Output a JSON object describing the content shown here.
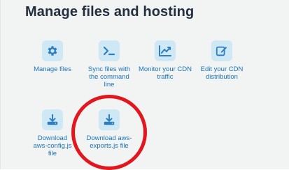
{
  "section": {
    "title": "Manage files and hosting"
  },
  "tiles": [
    {
      "icon": "gear-icon",
      "label": "Manage files"
    },
    {
      "icon": "terminal-icon",
      "label": "Sync files with the command line"
    },
    {
      "icon": "line-chart-icon",
      "label": "Monitor your CDN traffic"
    },
    {
      "icon": "edit-icon",
      "label": "Edit your CDN distribution"
    },
    {
      "icon": "download-icon",
      "label": "Download aws-config.js file"
    },
    {
      "icon": "download-icon",
      "label": "Download aws-exports.js file"
    }
  ],
  "colors": {
    "title": "#232f3e",
    "link": "#1a73b8",
    "icon": "#2e7fc2",
    "icon_bg": "#cfe8f5",
    "highlight": "#e3161d",
    "card_bg": "#f2f3f3"
  }
}
